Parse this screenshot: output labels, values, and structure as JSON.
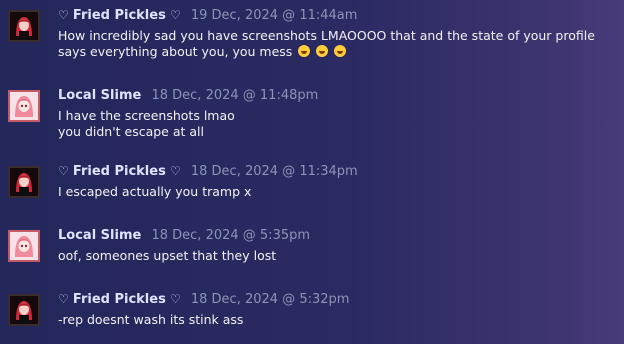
{
  "comments": [
    {
      "author": "Fried Pickles",
      "heart_prefix": "♡",
      "heart_suffix": "♡",
      "timestamp": "19 Dec, 2024 @ 11:44am",
      "lines": [
        "How incredibly sad you have screenshots LMAOOOO that and the state of your profile",
        "says everything about you, you mess"
      ],
      "emoji": [
        "grinning-squint-emoji",
        "grinning-squint-emoji",
        "grinning-squint-emoji"
      ]
    },
    {
      "author": "Local Slime",
      "timestamp": "18 Dec, 2024 @ 11:48pm",
      "lines": [
        "I have the screenshots lmao",
        "you didn't escape at all"
      ]
    },
    {
      "author": "Fried Pickles",
      "heart_prefix": "♡",
      "heart_suffix": "♡",
      "timestamp": "18 Dec, 2024 @ 11:34pm",
      "lines": [
        "I escaped actually you tramp x"
      ]
    },
    {
      "author": "Local Slime",
      "timestamp": "18 Dec, 2024 @ 5:35pm",
      "lines": [
        "oof, someones upset that they lost"
      ]
    },
    {
      "author": "Fried Pickles",
      "heart_prefix": "♡",
      "heart_suffix": "♡",
      "timestamp": "18 Dec, 2024 @ 5:32pm",
      "lines": [
        "-rep doesnt wash its stink ass"
      ]
    }
  ]
}
